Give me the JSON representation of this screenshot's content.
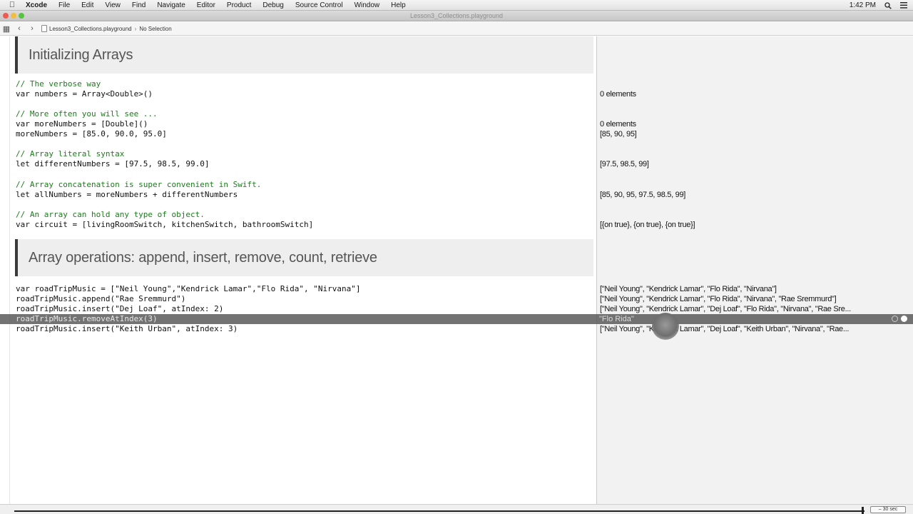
{
  "menubar": {
    "items": [
      "Xcode",
      "File",
      "Edit",
      "View",
      "Find",
      "Navigate",
      "Editor",
      "Product",
      "Debug",
      "Source Control",
      "Window",
      "Help"
    ],
    "clock": "1:42 PM"
  },
  "window": {
    "title": "Lesson3_Collections.playground"
  },
  "jumpbar": {
    "file": "Lesson3_Collections.playground",
    "selection": "No Selection"
  },
  "editor": {
    "headings": [
      "Initializing Arrays",
      "Array operations: append, insert, remove, count, retrieve"
    ],
    "code": [
      {
        "text": "// The verbose way",
        "comment": true
      },
      {
        "text": "var numbers = Array<Double>()",
        "comment": false
      },
      {
        "text": "// More often you will see ...",
        "comment": true
      },
      {
        "text": "var moreNumbers = [Double]()",
        "comment": false
      },
      {
        "text": "moreNumbers = [85.0, 90.0, 95.0]",
        "comment": false
      },
      {
        "text": "// Array literal syntax",
        "comment": true
      },
      {
        "text": "let differentNumbers = [97.5, 98.5, 99.0]",
        "comment": false
      },
      {
        "text": "// Array concatenation is super convenient in Swift.",
        "comment": true
      },
      {
        "text": "let allNumbers = moreNumbers + differentNumbers",
        "comment": false
      },
      {
        "text": "// An array can hold any type of object.",
        "comment": true
      },
      {
        "text": "var circuit = [livingRoomSwitch, kitchenSwitch, bathroomSwitch]",
        "comment": false
      },
      {
        "text": "var roadTripMusic = [\"Neil Young\",\"Kendrick Lamar\",\"Flo Rida\", \"Nirvana\"]",
        "comment": false
      },
      {
        "text": "roadTripMusic.append(\"Rae Sremmurd\")",
        "comment": false
      },
      {
        "text": "roadTripMusic.insert(\"Dej Loaf\", atIndex: 2)",
        "comment": false
      },
      {
        "text": "roadTripMusic.removeAtIndex(3)",
        "comment": false
      },
      {
        "text": "roadTripMusic.insert(\"Keith Urban\", atIndex: 3)",
        "comment": false
      }
    ]
  },
  "results": [
    "0 elements",
    "0 elements",
    "[85, 90, 95]",
    "[97.5, 98.5, 99]",
    "[85, 90, 95, 97.5, 98.5, 99]",
    "[{on true}, {on true}, {on true}]",
    "[\"Neil Young\", \"Kendrick Lamar\", \"Flo Rida\", \"Nirvana\"]",
    "[\"Neil Young\", \"Kendrick Lamar\", \"Flo Rida\", \"Nirvana\", \"Rae Sremmurd\"]",
    "[\"Neil Young\", \"Kendrick Lamar\", \"Dej Loaf\", \"Flo Rida\", \"Nirvana\", \"Rae Sre...",
    "\"Flo Rida\"",
    "[\"Neil Young\", \"Kendrick Lamar\", \"Dej Loaf\", \"Keith Urban\", \"Nirvana\", \"Rae..."
  ],
  "timeline": {
    "duration": "30 sec"
  },
  "colors": {
    "comment": "#1f7a1f",
    "heading_bg": "#eeeeee",
    "results_bg": "#f2f2f2"
  }
}
